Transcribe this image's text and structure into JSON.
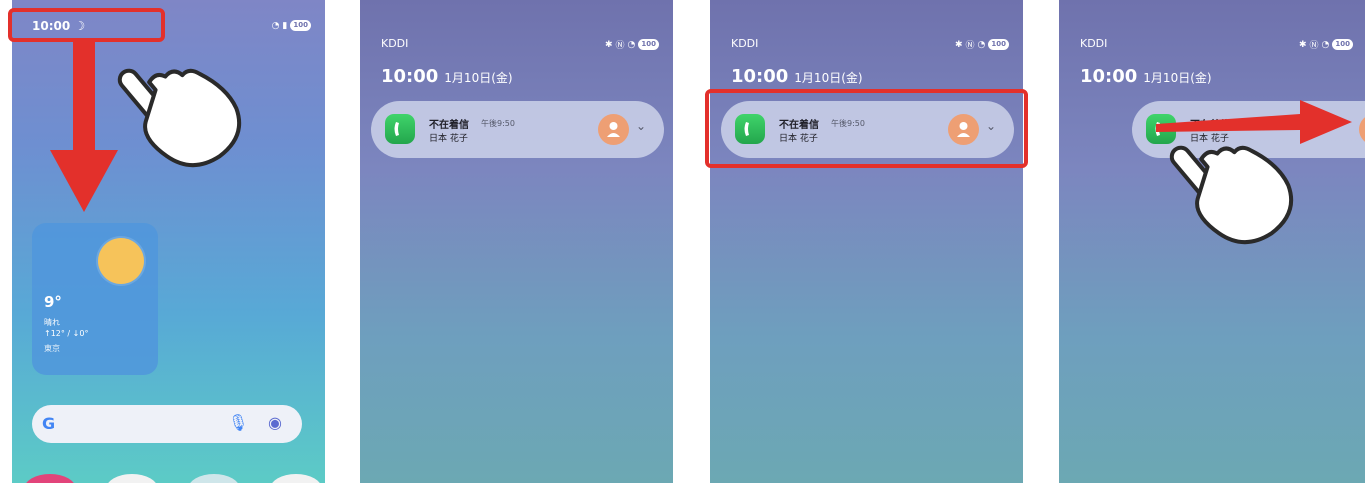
{
  "screen1": {
    "status_time": "10:00",
    "battery": "100",
    "weather": {
      "temperature": "9°",
      "condition": "晴れ",
      "range": "↑12° / ↓0°",
      "city": "東京"
    },
    "search_bar": {
      "logo": "G"
    }
  },
  "lockscreen": {
    "carrier": "KDDI",
    "time": "10:00",
    "date": "1月10日(金)",
    "battery": "100",
    "notification": {
      "title": "不在着信",
      "time": "午後9:50",
      "caller": "日本 花子"
    }
  },
  "colors": {
    "highlight_red": "#e3302b",
    "phone_green": "#2dbb57",
    "avatar_orange": "#ee9f74"
  }
}
